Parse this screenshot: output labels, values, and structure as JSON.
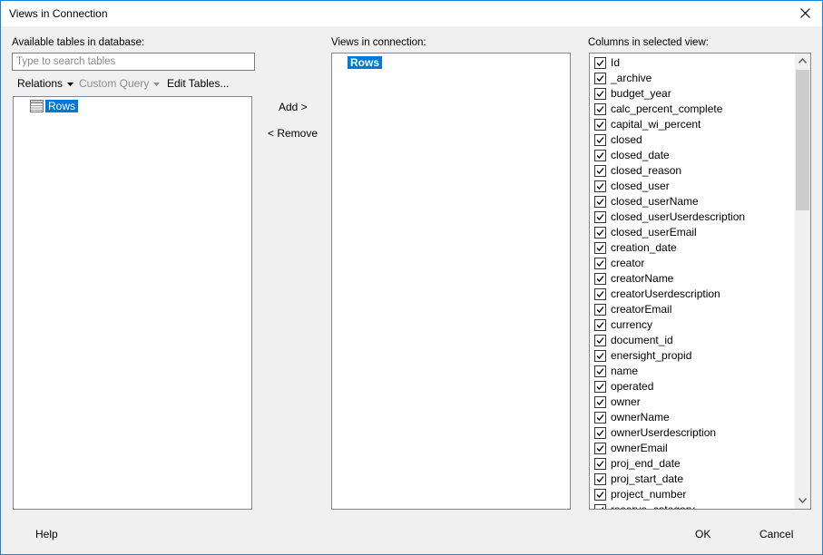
{
  "window": {
    "title": "Views in Connection"
  },
  "available": {
    "label": "Available tables in database:",
    "search_placeholder": "Type to search tables",
    "toolbar": {
      "relations": "Relations",
      "custom_query": "Custom Query",
      "edit_tables": "Edit Tables..."
    },
    "items": [
      {
        "label": "Rows",
        "icon": "table-icon",
        "selected": true
      }
    ]
  },
  "actions": {
    "add": "Add >",
    "remove": "< Remove"
  },
  "views": {
    "label": "Views in connection:",
    "items": [
      {
        "label": "Rows",
        "selected": true
      }
    ]
  },
  "columns": {
    "label": "Columns in selected view:",
    "items": [
      "Id",
      "_archive",
      "budget_year",
      "calc_percent_complete",
      "capital_wi_percent",
      "closed",
      "closed_date",
      "closed_reason",
      "closed_user",
      "closed_userName",
      "closed_userUserdescription",
      "closed_userEmail",
      "creation_date",
      "creator",
      "creatorName",
      "creatorUserdescription",
      "creatorEmail",
      "currency",
      "document_id",
      "enersight_propid",
      "name",
      "operated",
      "owner",
      "ownerName",
      "ownerUserdescription",
      "ownerEmail",
      "proj_end_date",
      "proj_start_date",
      "project_number",
      "reserve_category"
    ]
  },
  "footer": {
    "help": "Help",
    "ok": "OK",
    "cancel": "Cancel"
  },
  "colors": {
    "accent": "#0078d7",
    "border": "#1883d7",
    "dialog_bg": "#f0f0f0"
  }
}
